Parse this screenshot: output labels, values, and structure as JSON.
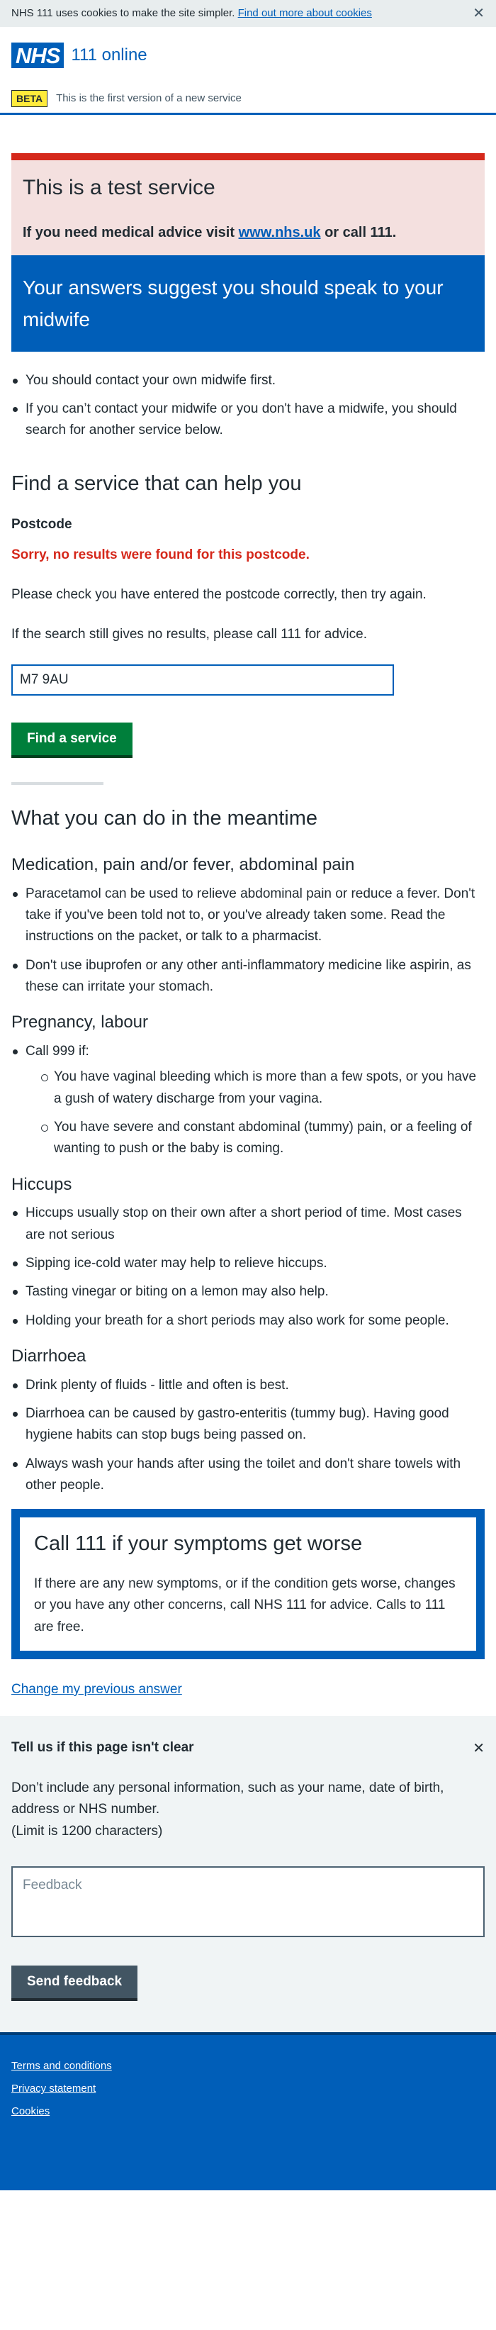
{
  "cookie_banner": {
    "text": "NHS 111 uses cookies to make the site simpler.",
    "link": "Find out more about cookies",
    "close": "✕"
  },
  "header": {
    "logo": "NHS",
    "service": "111 online"
  },
  "phase_banner": {
    "tag": "BETA",
    "text": "This is the first version of a new service"
  },
  "test_service": {
    "title": "This is a test service",
    "text_before": "If you need medical advice visit",
    "link": "www.nhs.uk",
    "text_after": "or call 111."
  },
  "care_card": {
    "title": "Your answers suggest you should speak to your midwife"
  },
  "intro_list": [
    "You should contact your own midwife first.",
    "If you can’t contact your midwife or you don't have a midwife, you should search for another service below."
  ],
  "service_search": {
    "heading": "Find a service that can help you",
    "label": "Postcode",
    "error": "Sorry, no results were found for this postcode.",
    "para1": "Please check you have entered the postcode correctly, then try again.",
    "para2": "If the search still gives no results, please call 111 for advice.",
    "postcode_value": "M7 9AU",
    "button": "Find a service"
  },
  "meantime": {
    "heading": "What you can do in the meantime",
    "sections": {
      "medication": {
        "title": "Medication, pain and/or fever, abdominal pain",
        "items": [
          "Paracetamol can be used to relieve abdominal pain or reduce a fever. Don't take if you've been told not to, or you've already taken some. Read the instructions on the packet, or talk to a pharmacist.",
          "Don't use ibuprofen or any other anti-inflammatory medicine like aspirin, as these can irritate your stomach."
        ]
      },
      "pregnancy": {
        "title": "Pregnancy, labour",
        "call": "Call 999 if:",
        "items": [
          "You have vaginal bleeding which is more than a few spots, or you have a gush of watery discharge from your vagina.",
          "You have severe and constant abdominal (tummy) pain, or a feeling of wanting to push or the baby is coming."
        ]
      },
      "hiccups": {
        "title": "Hiccups",
        "items": [
          "Hiccups usually stop on their own after a short period of time. Most cases are not serious",
          "Sipping ice-cold water may help to relieve hiccups.",
          "Tasting vinegar or biting on a lemon may also help.",
          "Holding your breath for a short periods may also work for some people."
        ]
      },
      "diarrhoea": {
        "title": "Diarrhoea",
        "items": [
          "Drink plenty of fluids - little and often is best.",
          "Diarrhoea can be caused by gastro-enteritis (tummy bug). Having good hygiene habits can stop bugs being passed on.",
          "Always wash your hands after using the toilet and don't share towels with other people."
        ]
      }
    }
  },
  "call_card": {
    "title": "Call 111 if your symptoms get worse",
    "text": "If there are any new symptoms, or if the condition gets worse, changes or you have any other concerns, call NHS 111 for advice. Calls to 111 are free."
  },
  "change_link": "Change my previous answer",
  "feedback": {
    "title": "Tell us if this page isn't clear",
    "close": "✕",
    "text1": "Don’t include any personal information, such as your name, date of birth, address or NHS number.",
    "text2": "(Limit is 1200 characters)",
    "placeholder": "Feedback",
    "button": "Send feedback"
  },
  "footer": {
    "links": [
      "Terms and conditions",
      "Privacy statement",
      "Cookies"
    ]
  },
  "colors": {
    "nhs_blue": "#005eb8",
    "nhs_green": "#007f3b",
    "error_red": "#d5281b",
    "beta_yellow": "#ffeb3b"
  }
}
